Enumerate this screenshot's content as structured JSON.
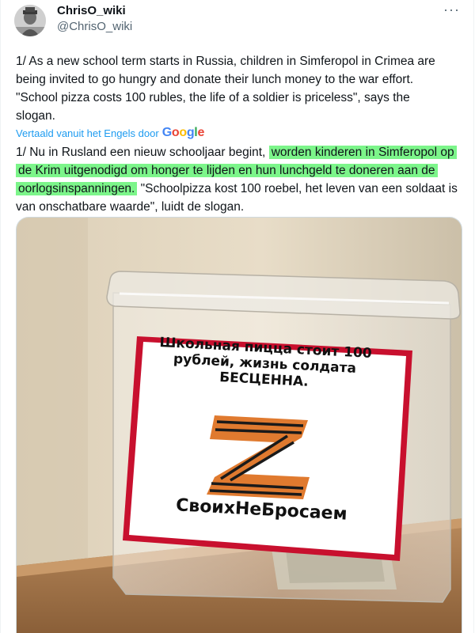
{
  "author": {
    "name": "ChrisO_wiki",
    "handle": "@ChrisO_wiki"
  },
  "menu": {
    "more_label": "···"
  },
  "tweet": {
    "text": "1/ As a new school term starts in Russia, children in Simferopol in Crimea are being invited to go hungry and donate their lunch money to the war effort. \"School pizza costs 100 rubles, the life of a soldier is priceless\", says the slogan.",
    "translated_label": "Vertaald vanuit het Engels door",
    "translator": "Google",
    "translation": {
      "part1": "1/ Nu in Rusland een nieuw schooljaar begint, ",
      "highlighted": "worden kinderen in Simferopol op de Krim uitgenodigd om honger te lijden en hun lunchgeld te doneren aan de oorlogsinspanningen.",
      "part2": " \"Schoolpizza kost 100 roebel, het leven van een soldaat is van onschatbare waarde\", luidt de slogan."
    }
  },
  "photo": {
    "sign_line1": "Школьная пицца стоит 100",
    "sign_line2": "рублей, жизнь солдата",
    "sign_line3": "БЕСЦЕННА.",
    "sign_hashtag": "СвоихНеБросаем"
  },
  "colors": {
    "link": "#1d9bf0",
    "highlight": "#7cf58a",
    "sign_border": "#c8102e",
    "ribbon_orange": "#e07a2f",
    "ribbon_black": "#1a1a1a"
  }
}
